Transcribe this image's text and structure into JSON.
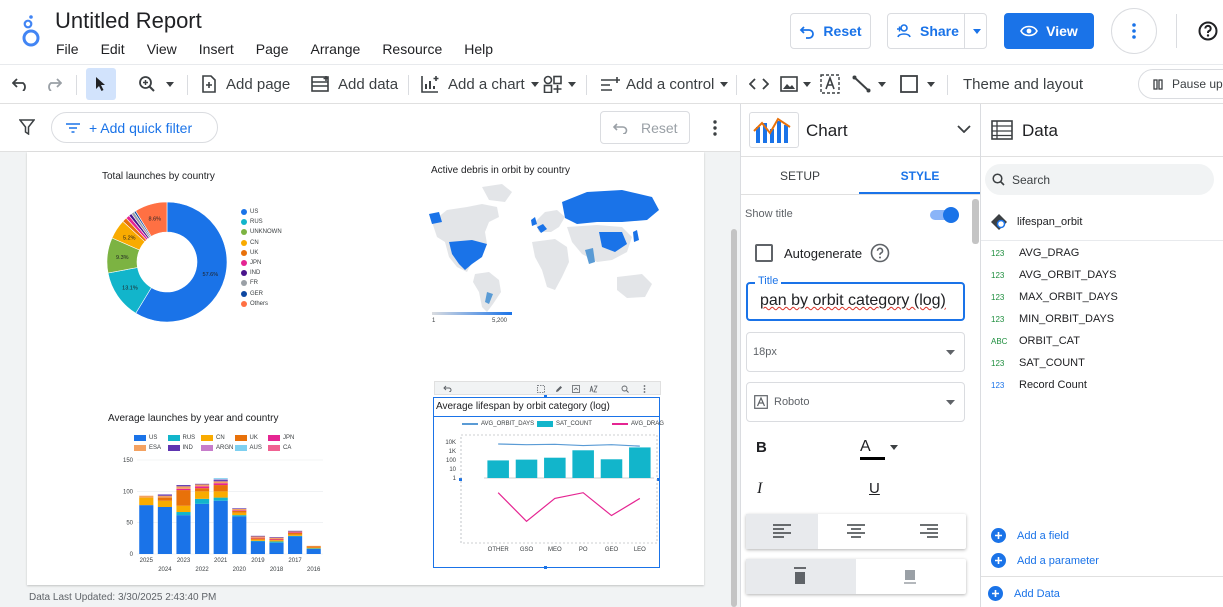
{
  "header": {
    "title": "Untitled Report",
    "menu": [
      "File",
      "Edit",
      "View",
      "Insert",
      "Page",
      "Arrange",
      "Resource",
      "Help"
    ],
    "reset_label": "Reset",
    "share_label": "Share",
    "view_label": "View",
    "accent": "#1a73e8"
  },
  "toolbar": {
    "add_page": "Add page",
    "add_data": "Add data",
    "add_chart": "Add a chart",
    "add_control": "Add a control",
    "theme_layout": "Theme and layout",
    "pause": "Pause up"
  },
  "filterbar": {
    "add_quick_filter": "+ Add quick filter",
    "reset_label": "Reset"
  },
  "canvas": {
    "last_updated": "Data Last Updated: 3/30/2025 2:43:40 PM"
  },
  "chart_data": [
    {
      "type": "pie",
      "title": "Total launches by country",
      "labels": [
        "US",
        "RUS",
        "UNKNOWN",
        "CN",
        "UK",
        "JPN",
        "IND",
        "FR",
        "GER",
        "Others"
      ],
      "values": [
        57.6,
        13.1,
        9.3,
        5.2,
        1.2,
        1.0,
        0.8,
        0.8,
        0.5,
        8.6
      ],
      "slice_labels": [
        "57.6%",
        "13.1%",
        "9.3%",
        "5.2%",
        "",
        "",
        "",
        "",
        "",
        "8.6%"
      ],
      "colors": [
        "#1a73e8",
        "#12b5cb",
        "#7cb342",
        "#f9ab00",
        "#e8710a",
        "#e52592",
        "#4a148c",
        "#9aa0a6",
        "#0d47a1",
        "#ff7043"
      ],
      "legend_position": "right"
    },
    {
      "type": "heatmap",
      "title": "Active debris in orbit by country",
      "scale_min_label": "1",
      "scale_max_label": "5,200",
      "colors": [
        "#dadce0",
        "#1a73e8"
      ]
    },
    {
      "type": "bar",
      "title": "Average launches by year and country",
      "categories": [
        "2025",
        "2024",
        "2023",
        "2022",
        "2021",
        "2020",
        "2019",
        "2018",
        "2017",
        "2016"
      ],
      "series": [
        {
          "name": "US",
          "values": [
            78,
            75,
            62,
            80,
            85,
            60,
            20,
            18,
            28,
            8
          ]
        },
        {
          "name": "RUS",
          "values": [
            0,
            0,
            5,
            8,
            5,
            2,
            1,
            2,
            1,
            1
          ]
        },
        {
          "name": "CN",
          "values": [
            12,
            10,
            10,
            12,
            10,
            4,
            2,
            2,
            2,
            1
          ]
        },
        {
          "name": "UK",
          "values": [
            0,
            5,
            25,
            5,
            10,
            3,
            2,
            1,
            3,
            2
          ]
        },
        {
          "name": "JPN",
          "values": [
            0,
            0,
            2,
            3,
            3,
            1,
            1,
            1,
            1,
            0
          ]
        },
        {
          "name": "ESA",
          "values": [
            3,
            3,
            4,
            3,
            3,
            2,
            2,
            2,
            1,
            1
          ]
        },
        {
          "name": "IND",
          "values": [
            0,
            2,
            2,
            1,
            2,
            1,
            1,
            1,
            1,
            0
          ]
        },
        {
          "name": "ARGN",
          "values": [
            0,
            0,
            0,
            0,
            1,
            0,
            0,
            0,
            0,
            0
          ]
        },
        {
          "name": "AUS",
          "values": [
            0,
            0,
            0,
            0,
            2,
            0,
            0,
            0,
            0,
            0
          ]
        },
        {
          "name": "CA",
          "values": [
            0,
            0,
            0,
            0,
            0,
            0,
            0,
            0,
            0,
            0
          ]
        }
      ],
      "colors": [
        "#1a73e8",
        "#12b5cb",
        "#f9ab00",
        "#e8710a",
        "#e52592",
        "#f4a261",
        "#5e35b1",
        "#c77dcb",
        "#7ed0f0",
        "#f06292"
      ],
      "ylim": [
        0,
        150
      ],
      "yticks": [
        "0",
        "50",
        "100",
        "150"
      ],
      "xticks_top": [
        "2025",
        "2023",
        "2021",
        "2019",
        "2017"
      ],
      "xticks_bottom": [
        "2024",
        "2022",
        "2020",
        "2018",
        "2016"
      ]
    },
    {
      "type": "bar",
      "title": "Average lifespan by orbit category (log)",
      "categories": [
        "OTHER",
        "GSO",
        "MEO",
        "PO",
        "GEO",
        "LEO"
      ],
      "series": [
        {
          "name": "AVG_ORBIT_DAYS",
          "values": [
            6000,
            5000,
            5500,
            4000,
            5000,
            3500
          ]
        },
        {
          "name": "SAT_COUNT",
          "values": [
            90,
            110,
            180,
            1200,
            120,
            2500
          ]
        },
        {
          "name": "AVG_DRAG",
          "values": [
            0.0006,
            0.0001,
            0.0005,
            0.0006,
            0.0002,
            0.0005
          ]
        }
      ],
      "legend": [
        "AVG_ORBIT_DAYS",
        "SAT_COUNT",
        "AVG_DRAG"
      ],
      "yticks": [
        "10K",
        "1K",
        "100",
        "10",
        "1"
      ],
      "colors": [
        "#5a9bd5",
        "#12b5cb",
        "#e52592"
      ],
      "yscale": "log"
    }
  ],
  "props_panel": {
    "header": "Chart",
    "tab_setup": "SETUP",
    "tab_style": "STYLE",
    "show_title": "Show title",
    "autogenerate": "Autogenerate",
    "title_label": "Title",
    "title_value": "pan by orbit category (log)",
    "font_size": "18px",
    "font_family": "Roboto"
  },
  "data_panel": {
    "header": "Data",
    "search_placeholder": "Search",
    "source": "lifespan_orbit",
    "fields": [
      {
        "type": "123",
        "name": "AVG_DRAG"
      },
      {
        "type": "123",
        "name": "AVG_ORBIT_DAYS"
      },
      {
        "type": "123",
        "name": "MAX_ORBIT_DAYS"
      },
      {
        "type": "123",
        "name": "MIN_ORBIT_DAYS"
      },
      {
        "type": "ABC",
        "name": "ORBIT_CAT"
      },
      {
        "type": "123",
        "name": "SAT_COUNT"
      },
      {
        "type": "123",
        "name": "Record Count"
      }
    ],
    "add_field": "Add a field",
    "add_parameter": "Add a parameter",
    "add_data": "Add Data"
  }
}
